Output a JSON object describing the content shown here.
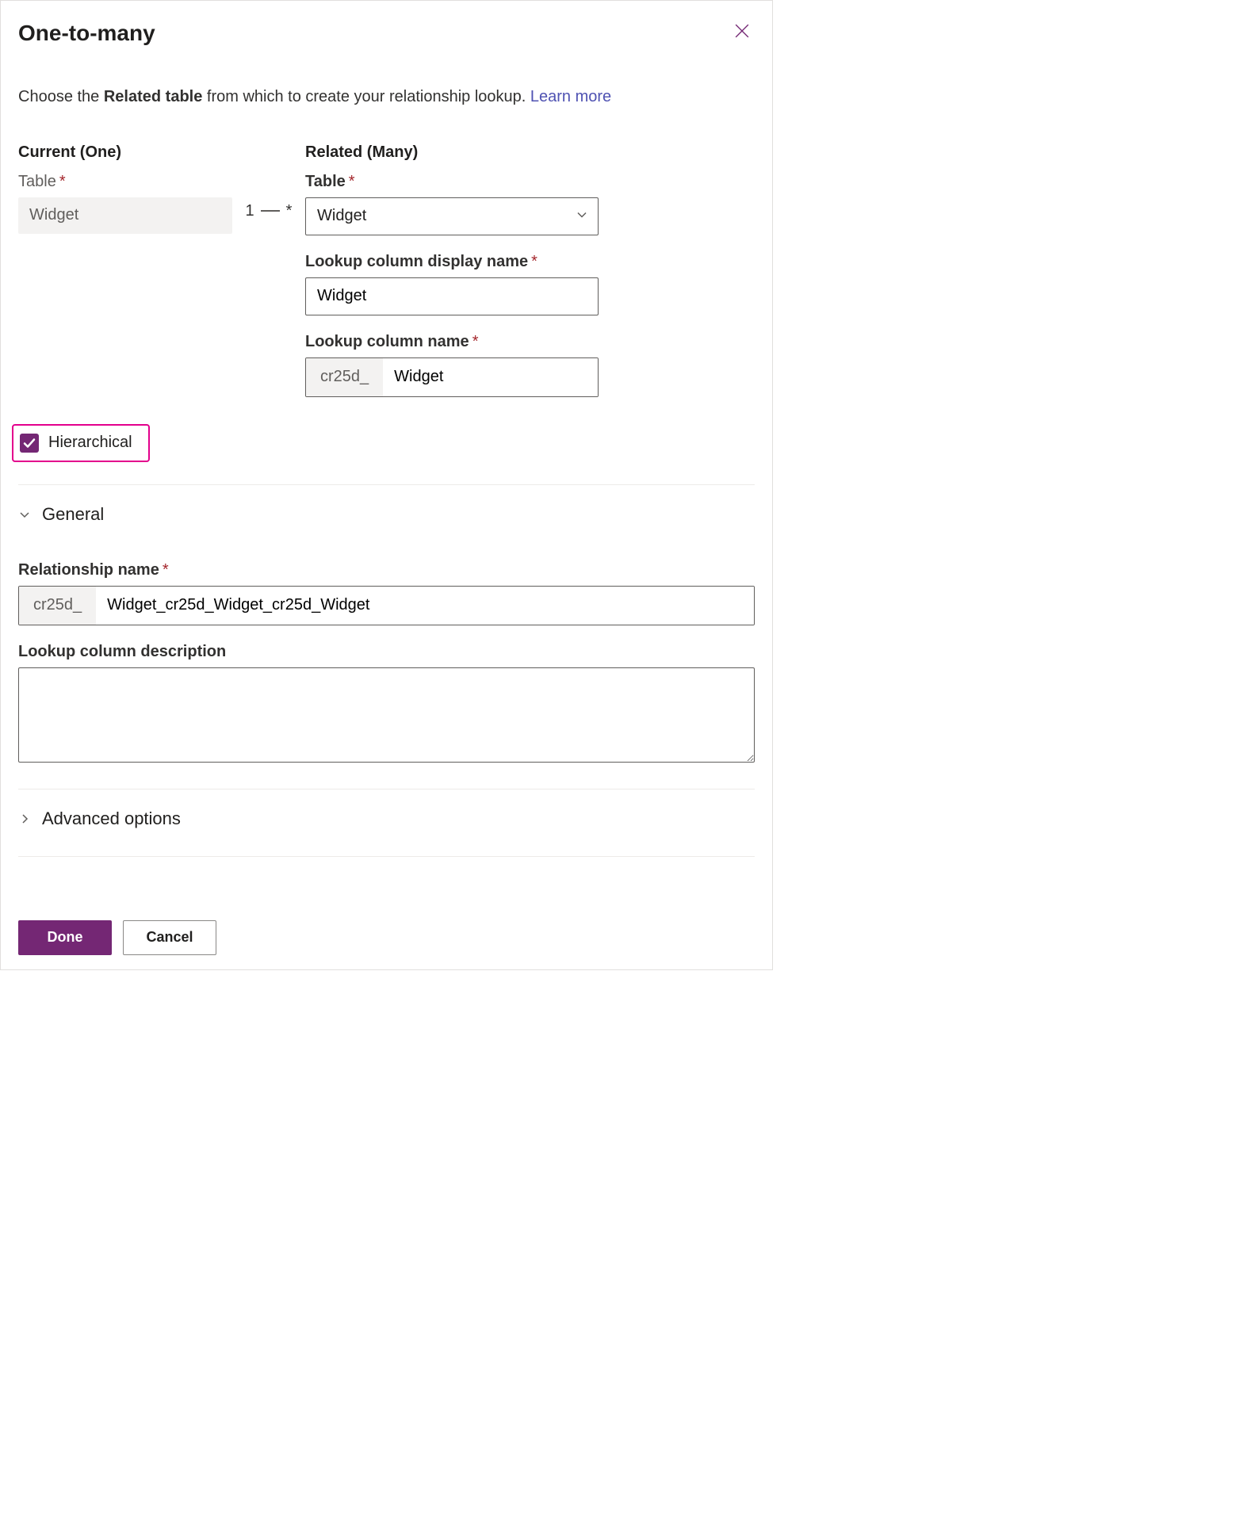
{
  "title": "One-to-many",
  "intro": {
    "prefix": "Choose the ",
    "bold": "Related table",
    "suffix": " from which to create your relationship lookup. ",
    "link": "Learn more"
  },
  "current": {
    "heading": "Current (One)",
    "table_label": "Table",
    "table_value": "Widget"
  },
  "cardinality": {
    "one": "1",
    "many": "*"
  },
  "related": {
    "heading": "Related (Many)",
    "table_label": "Table",
    "table_value": "Widget",
    "display_name_label": "Lookup column display name",
    "display_name_value": "Widget",
    "column_name_label": "Lookup column name",
    "column_name_prefix": "cr25d_",
    "column_name_value": "Widget"
  },
  "hierarchical_label": "Hierarchical",
  "general": {
    "heading": "General",
    "relationship_name_label": "Relationship name",
    "relationship_prefix": "cr25d_",
    "relationship_value": "Widget_cr25d_Widget_cr25d_Widget",
    "description_label": "Lookup column description",
    "description_value": ""
  },
  "advanced_heading": "Advanced options",
  "buttons": {
    "done": "Done",
    "cancel": "Cancel"
  }
}
